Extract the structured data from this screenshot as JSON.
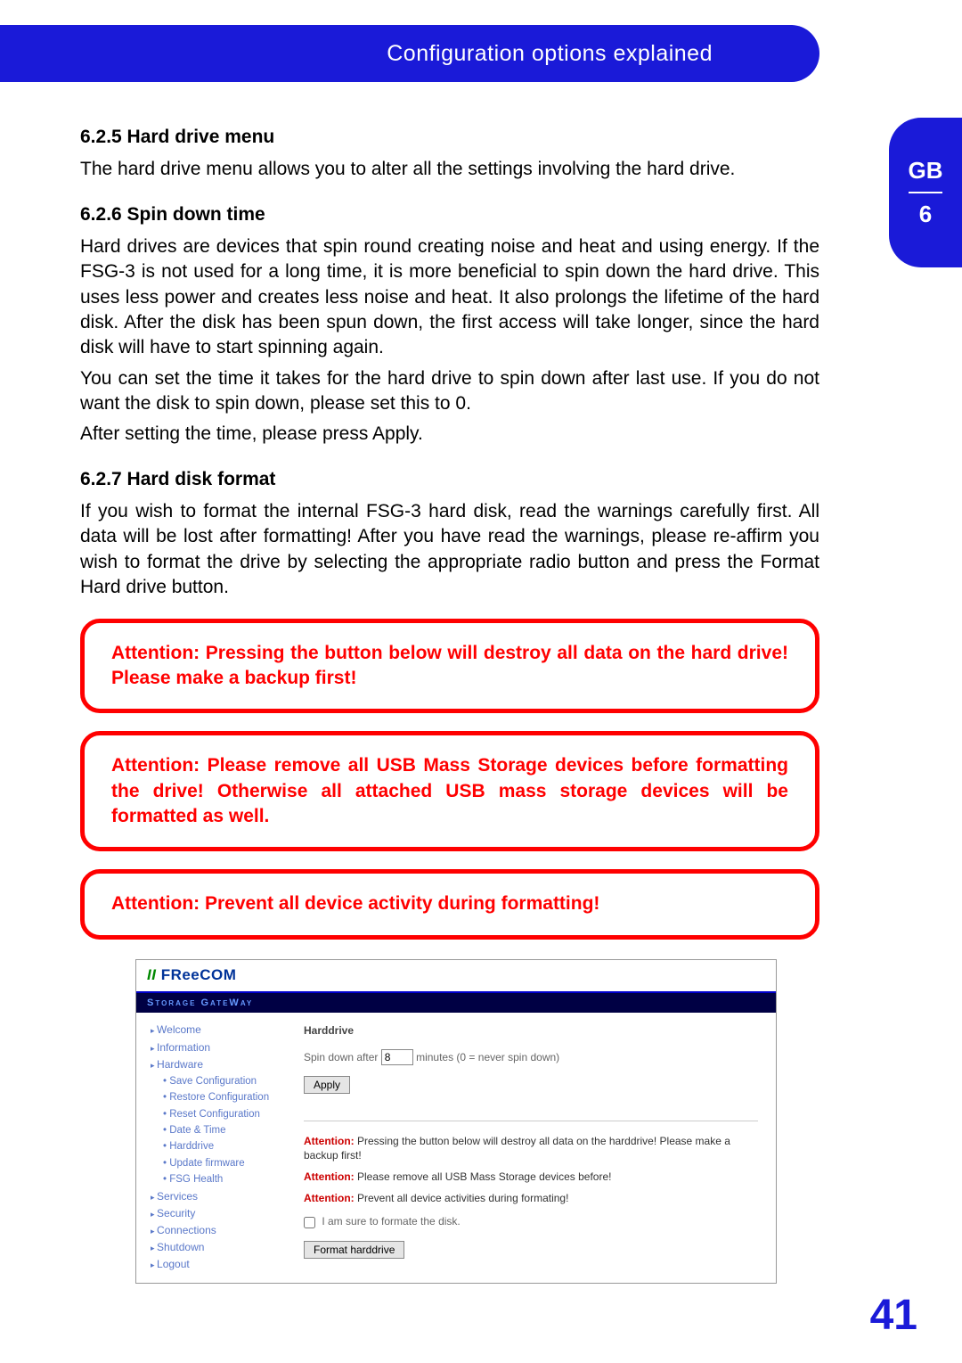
{
  "header": {
    "title": "Configuration options explained"
  },
  "side_tab": {
    "lang": "GB",
    "chapter": "6"
  },
  "sections": {
    "s1": {
      "heading": "6.2.5 Hard drive menu",
      "p1": "The hard drive menu allows you to alter all the settings involving the hard drive."
    },
    "s2": {
      "heading": "6.2.6 Spin down time",
      "p1": "Hard drives are devices that spin round creating noise and heat and using energy. If the FSG-3 is not used for a long time, it is more beneficial to spin down the hard drive. This uses less power and creates less noise and heat. It also prolongs the lifetime of the hard disk. After the disk has been spun down, the first access will take longer, since the hard disk will have to start spinning again.",
      "p2": "You can set the time it takes for the hard drive to spin down after last use. If you do not want the disk to spin down, please set this to 0.",
      "p3": "After setting the time, please press Apply."
    },
    "s3": {
      "heading": "6.2.7 Hard disk format",
      "p1": "If you wish to format the internal FSG-3 hard disk, read the warnings carefully first. All data will be lost after formatting! After you have read the warnings, please re-affirm you wish to format the drive by selecting the appropriate radio button and press the Format Hard drive button."
    }
  },
  "warnings": {
    "w1": "Attention: Pressing the button below will destroy all data on the hard drive! Please make a backup first!",
    "w2": "Attention: Please remove all USB Mass Storage devices before formatting the drive! Otherwise all attached USB mass storage devices will be formatted as well.",
    "w3": "Attention: Prevent all device activity during formatting!"
  },
  "screenshot": {
    "brand": "FReeCOM",
    "subhead": "Storage GateWay",
    "nav": {
      "welcome": "Welcome",
      "information": "Information",
      "hardware": "Hardware",
      "save_config": "Save Configuration",
      "restore_config": "Restore Configuration",
      "reset_config": "Reset Configuration",
      "date_time": "Date & Time",
      "harddrive": "Harddrive",
      "update_fw": "Update firmware",
      "fsg_health": "FSG Health",
      "services": "Services",
      "security": "Security",
      "connections": "Connections",
      "shutdown": "Shutdown",
      "logout": "Logout"
    },
    "main": {
      "title": "Harddrive",
      "spin_label_pre": "Spin down after",
      "spin_value": "8",
      "spin_label_post": "minutes (0 = never spin down)",
      "apply": "Apply",
      "att1_label": "Attention:",
      "att1_text": " Pressing the button below will destroy all data on the harddrive! Please make a backup first!",
      "att2_label": "Attention:",
      "att2_text": " Please remove all USB Mass Storage devices before!",
      "att3_label": "Attention:",
      "att3_text": " Prevent all device activities during formating!",
      "confirm": "I am sure to formate the disk.",
      "format_btn": "Format harddrive"
    }
  },
  "page_number": "41"
}
